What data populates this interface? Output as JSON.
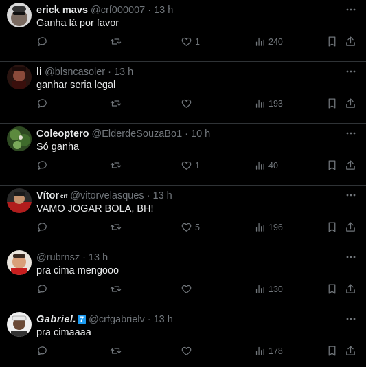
{
  "tweets": [
    {
      "name": "erick mavs",
      "badge": "",
      "handle": "@crf000007",
      "time": "13 h",
      "text": "Ganha lá por favor",
      "likes": "1",
      "views": "240",
      "avatar_color": "#6d6d6d"
    },
    {
      "name": "li",
      "badge": "",
      "handle": "@blsncasoler",
      "time": "13 h",
      "text": "ganhar seria legal",
      "likes": "",
      "views": "193",
      "avatar_color": "#5a2a24"
    },
    {
      "name": "Coleoptero",
      "badge": "",
      "handle": "@ElderdeSouzaBo1",
      "time": "10 h",
      "text": "Só ganha",
      "likes": "1",
      "views": "40",
      "avatar_color": "#3e5a2e"
    },
    {
      "name": "Vítor",
      "badge": "crf",
      "handle": "@vitorvelasques",
      "time": "13 h",
      "text": "VAMO JOGAR BOLA, BH!",
      "likes": "5",
      "views": "196",
      "avatar_color": "#b11d1d"
    },
    {
      "name": "",
      "badge": "",
      "handle": "@rubrnsz",
      "time": "13 h",
      "text": "pra cima mengooo",
      "likes": "",
      "views": "130",
      "avatar_color": "#c98a64"
    },
    {
      "name": "Gabriel.",
      "badge": "7",
      "handle": "@crfgabrielv",
      "time": "13 h",
      "text": "pra cimaaaa",
      "likes": "",
      "views": "178",
      "avatar_color": "#c9c9c9"
    }
  ],
  "separator": "·",
  "colors": {
    "background": "#000000",
    "text": "#e7e9ea",
    "muted": "#71767b",
    "border": "#2f3336",
    "blue": "#1d9bf0"
  },
  "icons": [
    "reply-icon",
    "retweet-icon",
    "heart-icon",
    "views-icon",
    "bookmark-icon",
    "share-icon",
    "more-icon"
  ]
}
